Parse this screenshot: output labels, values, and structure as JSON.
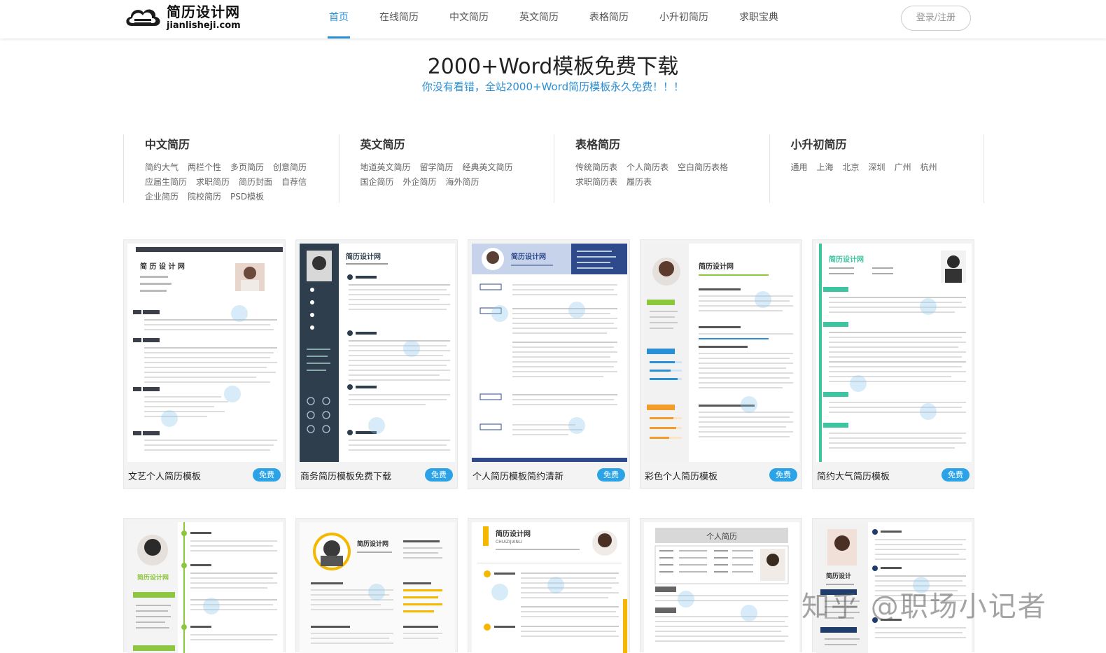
{
  "site": {
    "logo_name": "简历设计网",
    "logo_domain": "jianlisheji.com",
    "nav": [
      {
        "label": "首页",
        "active": true
      },
      {
        "label": "在线简历"
      },
      {
        "label": "中文简历"
      },
      {
        "label": "英文简历"
      },
      {
        "label": "表格简历"
      },
      {
        "label": "小升初简历"
      },
      {
        "label": "求职宝典"
      }
    ],
    "login_label": "登录/注册",
    "accent_color": "#2b8fd6"
  },
  "banner": {
    "title": "2000+Word模板免费下载",
    "subtitle": "你没有看错，全站2000+Word简历模板永久免费！！！"
  },
  "categories": [
    {
      "title": "中文简历",
      "links": [
        "简约大气",
        "两栏个性",
        "多页简历",
        "创意简历",
        "应届生简历",
        "求职简历",
        "简历封面",
        "自荐信",
        "企业简历",
        "院校简历",
        "PSD模板"
      ]
    },
    {
      "title": "英文简历",
      "links": [
        "地道英文简历",
        "留学简历",
        "经典英文简历",
        "国企简历",
        "外企简历",
        "海外简历"
      ]
    },
    {
      "title": "表格简历",
      "links": [
        "传统简历表",
        "个人简历表",
        "空白简历表格",
        "求职简历表",
        "履历表"
      ]
    },
    {
      "title": "小升初简历",
      "links": [
        "通用",
        "上海",
        "北京",
        "深圳",
        "广州",
        "杭州"
      ]
    }
  ],
  "templates_row1": [
    {
      "label": "文艺个人简历模板",
      "badge": "免费",
      "header_name": "简 历 设 计 网"
    },
    {
      "label": "商务简历模板免费下载",
      "badge": "免费",
      "header_name": "简历设计网"
    },
    {
      "label": "个人简历模板简约清新",
      "badge": "免费",
      "header_name": "简历设计网"
    },
    {
      "label": "彩色个人简历模板",
      "badge": "免费",
      "header_name": "简历设计网"
    },
    {
      "label": "简约大气简历模板",
      "badge": "免费",
      "header_name": "简历设计网"
    }
  ],
  "templates_row2": [
    {
      "header_name": "简历设计网"
    },
    {
      "header_name": "简历设计网"
    },
    {
      "header_name": "简历设计网",
      "header_sub": "CHUIZIJIANLI"
    },
    {
      "header_name": "个人简历"
    },
    {
      "header_name": "简历设计"
    }
  ],
  "watermark": "知乎 @职场小记者"
}
